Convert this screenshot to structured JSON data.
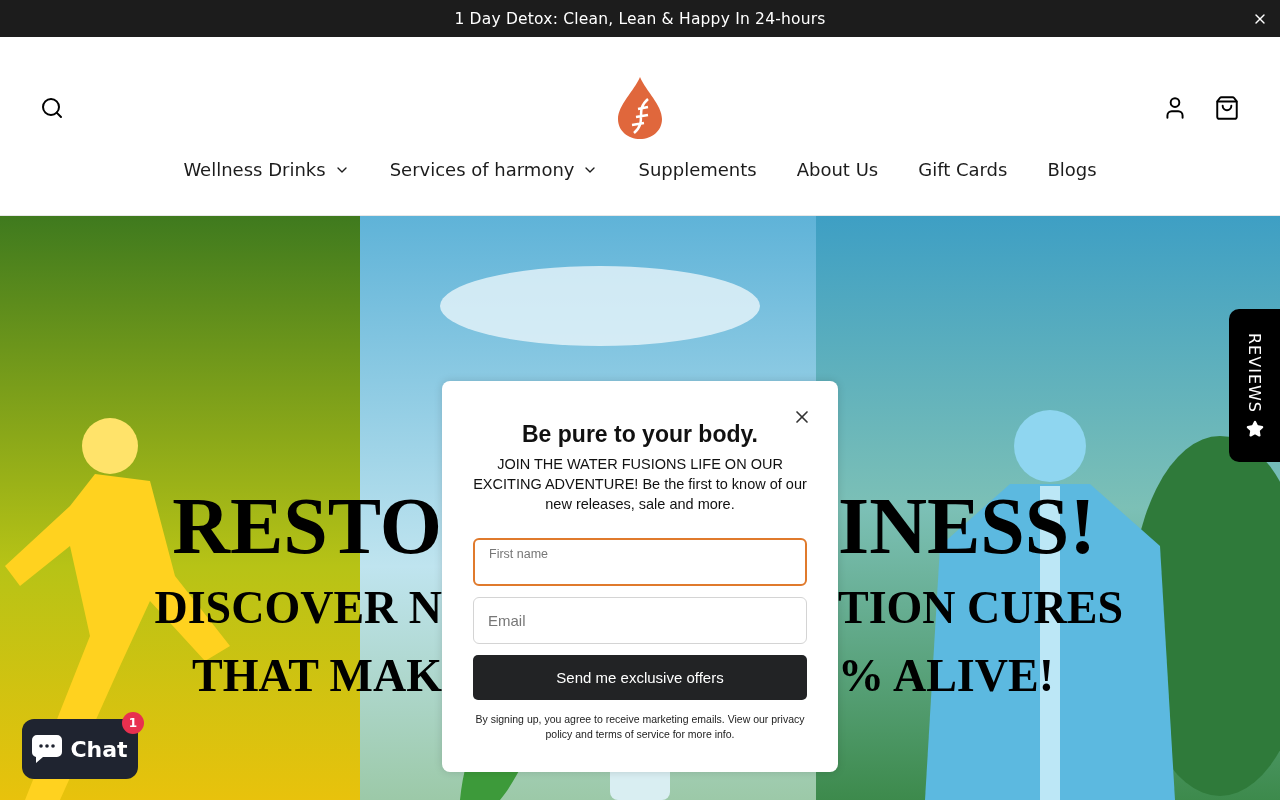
{
  "announcement": {
    "text": "1 Day Detox: Clean, Lean & Happy In 24-hours"
  },
  "nav": [
    {
      "label": "Wellness Drinks",
      "has_menu": true
    },
    {
      "label": "Services of harmony",
      "has_menu": true
    },
    {
      "label": "Supplements",
      "has_menu": false
    },
    {
      "label": "About Us",
      "has_menu": false
    },
    {
      "label": "Gift Cards",
      "has_menu": false
    },
    {
      "label": "Blogs",
      "has_menu": false
    }
  ],
  "hero": {
    "lines": [
      {
        "kind": "headline",
        "left": "RESTO",
        "right": "INESS!"
      },
      {
        "kind": "subline",
        "left": "DISCOVER N",
        "right": "TION CURES"
      },
      {
        "kind": "subline",
        "left": "THAT MAK",
        "right": "% ALIVE!"
      }
    ]
  },
  "popup": {
    "title": "Be pure to your body.",
    "body": "JOIN THE WATER FUSIONS LIFE ON OUR EXCITING ADVENTURE! Be the first to know of our new releases, sale and more.",
    "fields": [
      {
        "placeholder": "First name",
        "focused": true
      },
      {
        "placeholder": "Email",
        "focused": false
      }
    ],
    "button": "Send me exclusive offers",
    "disclaimer": "By signing up, you agree to receive marketing emails. View our privacy policy and terms of service for more info."
  },
  "chat": {
    "label": "Chat",
    "badge": "1"
  },
  "reviews_tab": {
    "label": "REVIEWS"
  }
}
